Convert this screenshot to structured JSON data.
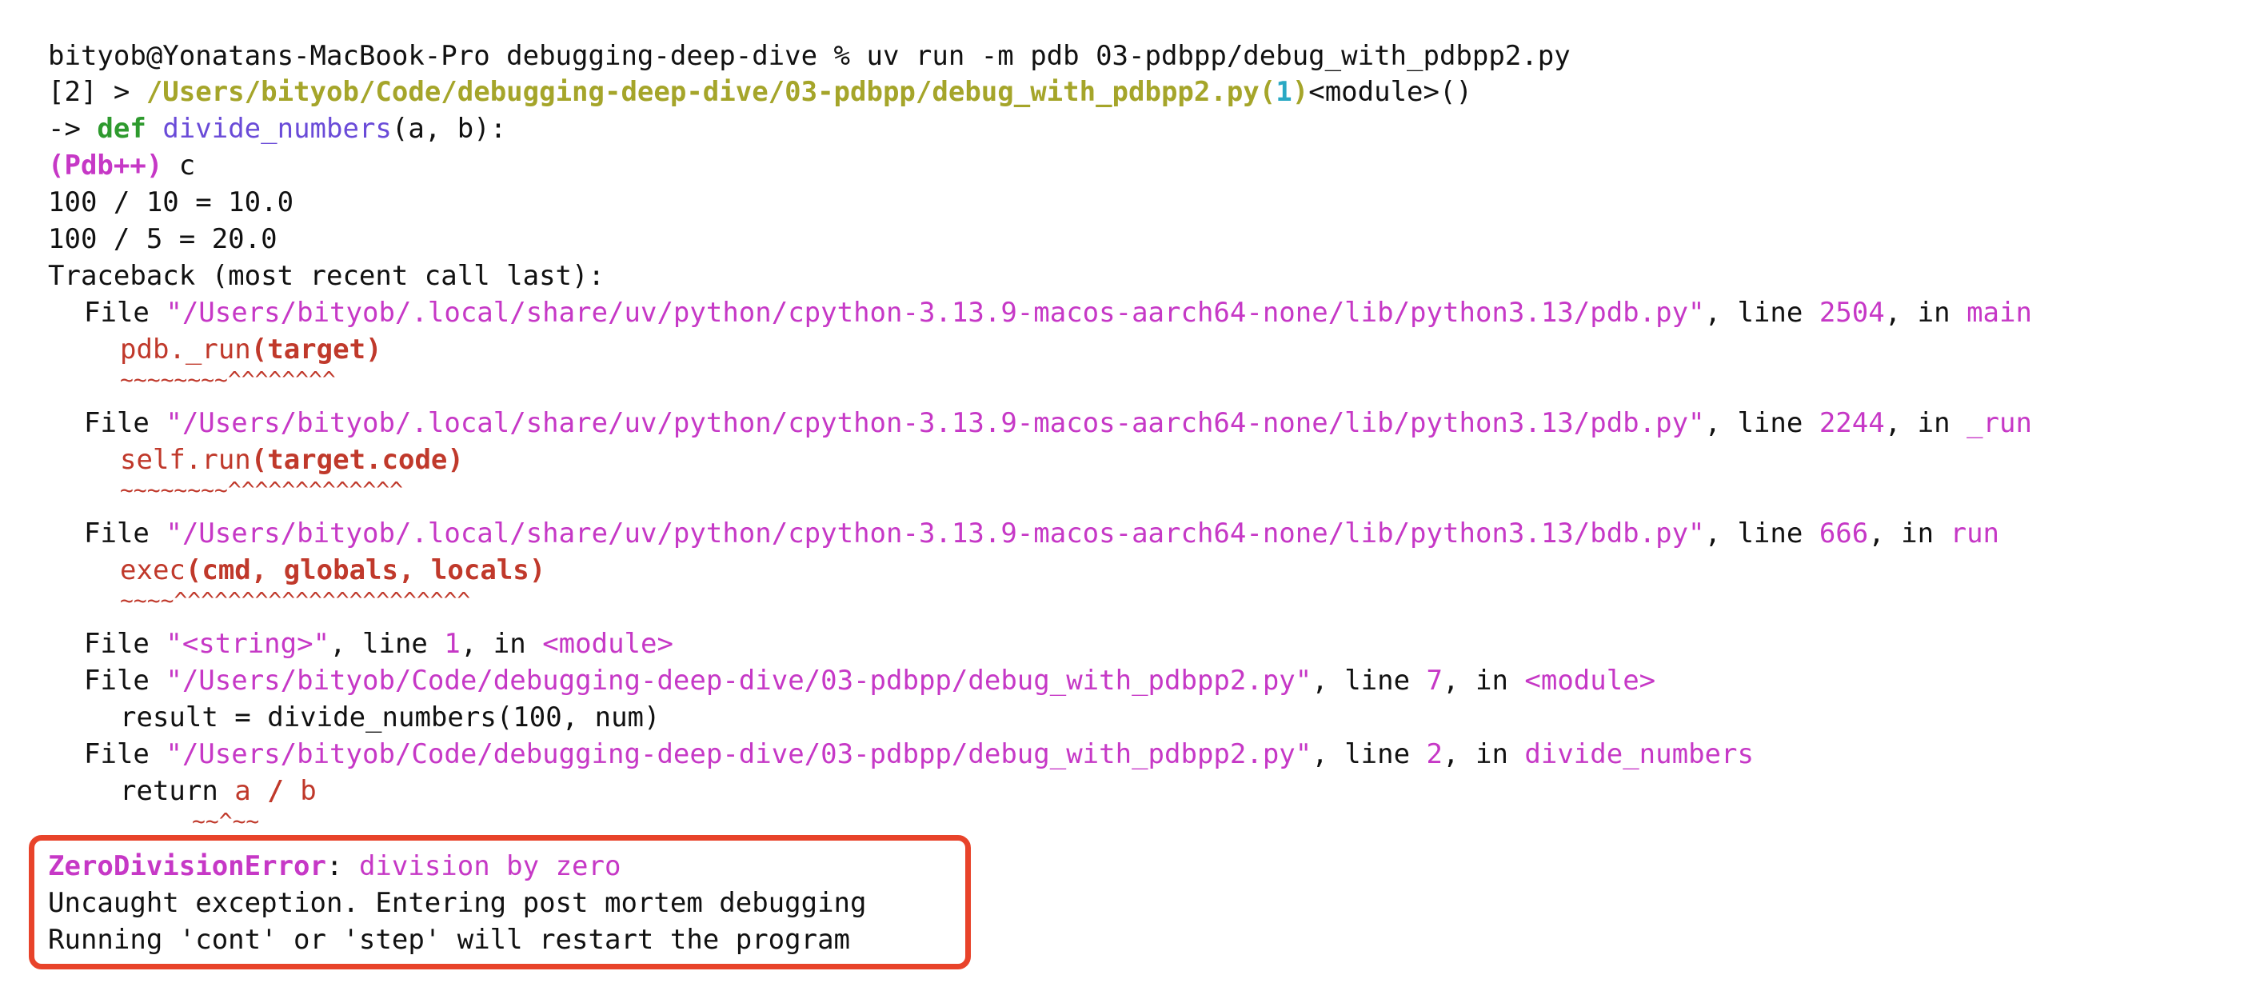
{
  "cut_off_line": "bityob@Yonatans-MacBook-Pro debugging-deep-dive % uv run -m pdb 03-pdbpp/debug_with_pdbpp2.py",
  "line1": {
    "prompt": "bityob@Yonatans-MacBook-Pro debugging-deep-dive %",
    "command": " uv run -m pdb 03-pdbpp/debug_with_pdbpp2.py"
  },
  "line2": {
    "prefix": "[2] > ",
    "path": "/Users/bityob/Code/debugging-deep-dive/03-pdbpp/debug_with_pdbpp2.py",
    "open": "(",
    "lineno": "1",
    "close": ")",
    "tail": "<module>()"
  },
  "line3": {
    "arrow": "-> ",
    "kw": "def",
    "fn": " divide_numbers",
    "args": "(a, b):"
  },
  "line4": {
    "pdb": "(Pdb++)",
    "cmd": " c"
  },
  "out1": "100 / 10 = 10.0",
  "out2": "100 / 5 = 20.0",
  "traceback_header": "Traceback (most recent call last):",
  "frames": [
    {
      "file": "\"/Users/bityob/.local/share/uv/python/cpython-3.13.9-macos-aarch64-none/lib/python3.13/pdb.py\"",
      "line": "2504",
      "func": "main",
      "code_pre": "pdb._run",
      "code_hl": "(target)",
      "marker": "~~~~~~~~^^^^^^^^"
    },
    {
      "file": "\"/Users/bityob/.local/share/uv/python/cpython-3.13.9-macos-aarch64-none/lib/python3.13/pdb.py\"",
      "line": "2244",
      "func": "_run",
      "code_pre": "self.run",
      "code_hl": "(target.code)",
      "marker": "~~~~~~~~^^^^^^^^^^^^^"
    },
    {
      "file": "\"/Users/bityob/.local/share/uv/python/cpython-3.13.9-macos-aarch64-none/lib/python3.13/bdb.py\"",
      "line": "666",
      "func": "run",
      "code_pre": "exec",
      "code_hl": "(cmd, globals, locals)",
      "marker": "~~~~^^^^^^^^^^^^^^^^^^^^^^"
    },
    {
      "file": "\"<string>\"",
      "line": "1",
      "func": "<module>"
    },
    {
      "file": "\"/Users/bityob/Code/debugging-deep-dive/03-pdbpp/debug_with_pdbpp2.py\"",
      "line": "7",
      "func": "<module>",
      "code_plain": "result = divide_numbers(100, num)"
    },
    {
      "file": "\"/Users/bityob/Code/debugging-deep-dive/03-pdbpp/debug_with_pdbpp2.py\"",
      "line": "2",
      "func": "divide_numbers",
      "code_kw": "return ",
      "code_a": "a",
      "code_op": " / ",
      "code_b": "b",
      "marker": "~~^~~"
    }
  ],
  "words": {
    "file": "File ",
    "line": ", line ",
    "in": ", in "
  },
  "error": {
    "name": "ZeroDivisionError",
    "colon": ":",
    "message": " division by zero"
  },
  "post1": "Uncaught exception. Entering post mortem debugging",
  "post2": "Running 'cont' or 'step' will restart the program",
  "colors": {
    "highlight_border": "#e8432a",
    "path": "#c638c6",
    "error": "#c0392b"
  }
}
